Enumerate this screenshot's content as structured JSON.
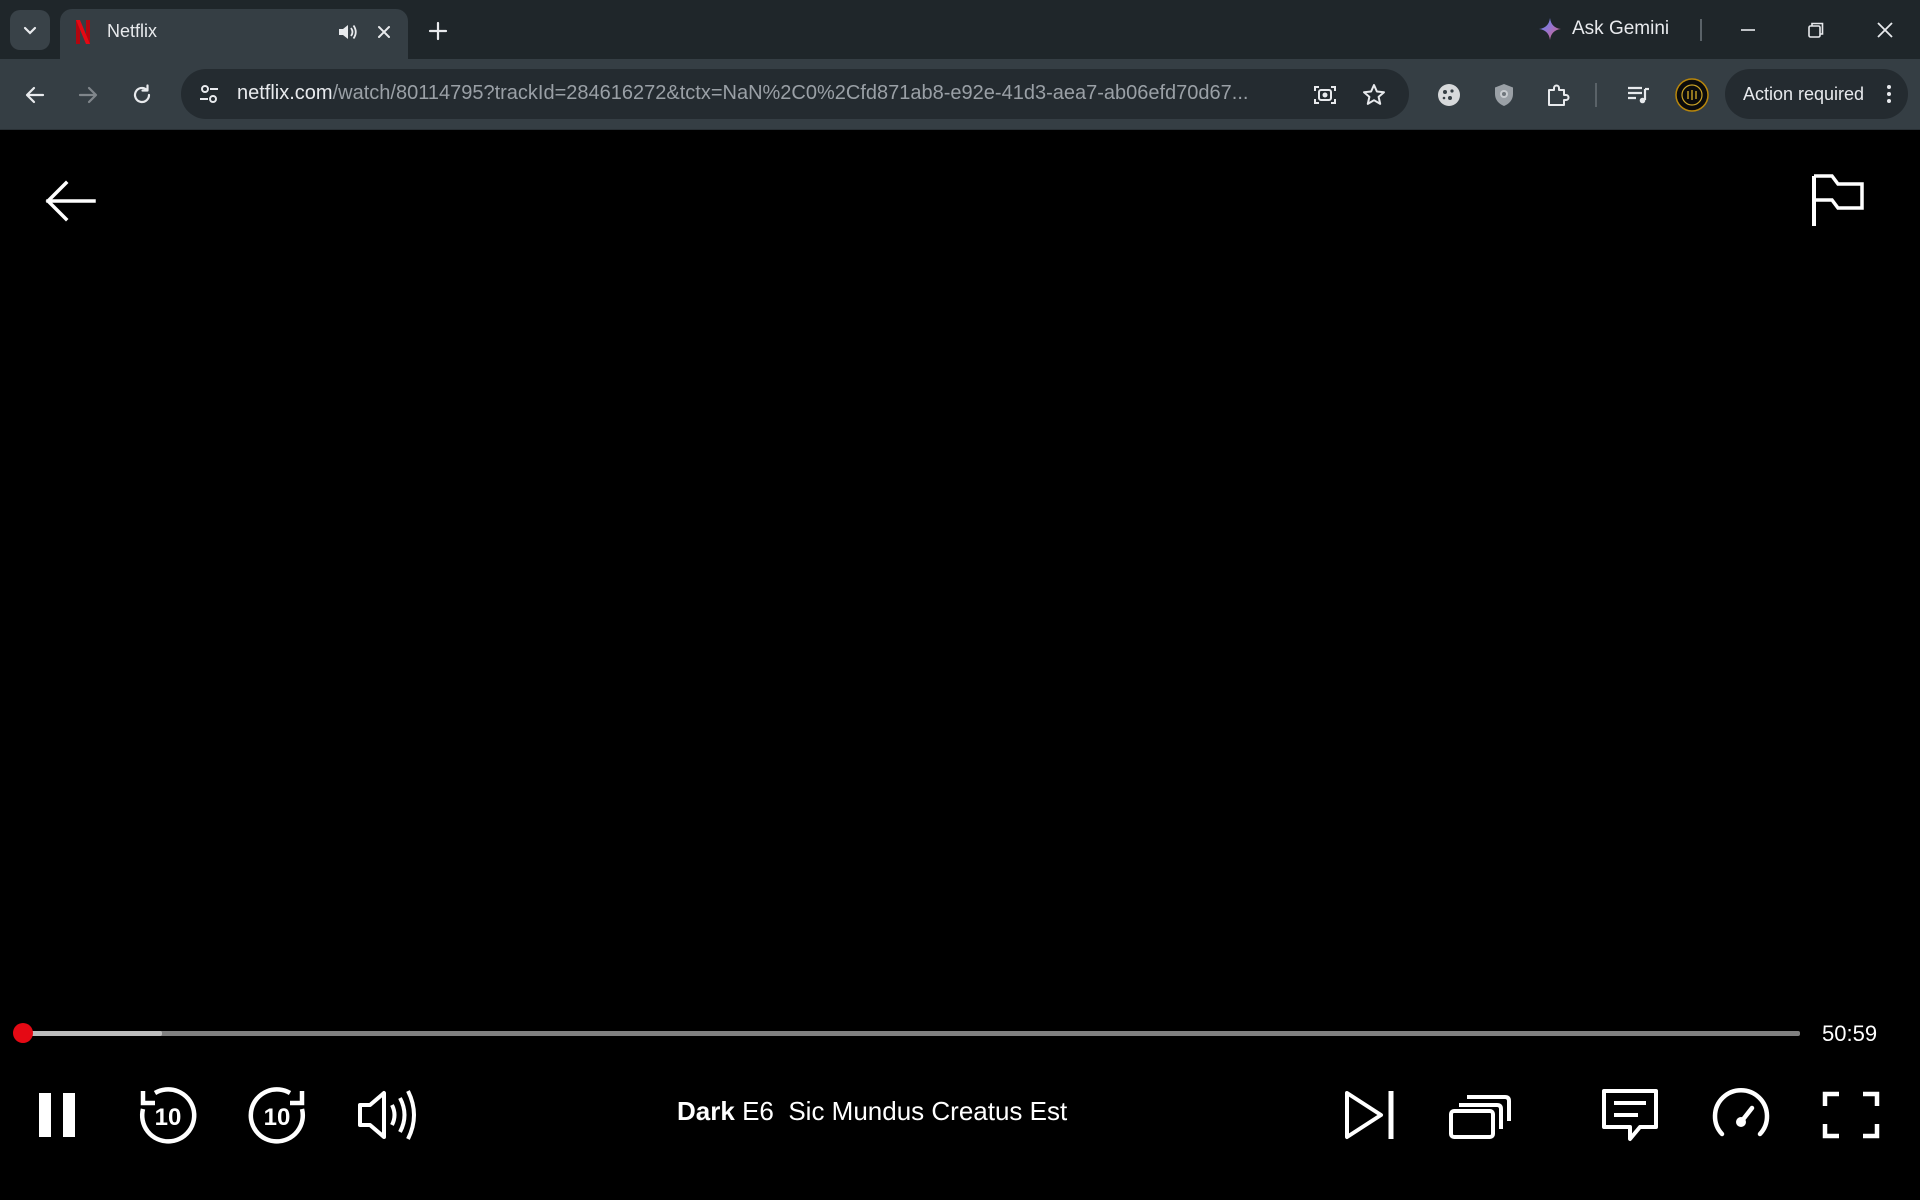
{
  "browser": {
    "tab": {
      "title": "Netflix"
    },
    "gemini_label": "Ask Gemini",
    "url_host": "netflix.com",
    "url_path": "/watch/80114795?trackId=284616272&tctx=NaN%2C0%2Cfd871ab8-e92e-41d3-aea7-ab06efd70d67...",
    "action_required_label": "Action required",
    "colors": {
      "tab_bar": "#1f262a",
      "toolbar": "#353e44",
      "omnibox": "#242b30",
      "netflix_red": "#e50914"
    }
  },
  "player": {
    "time_remaining": "50:59",
    "progress_fraction": 0.003,
    "buffered_fraction": 0.081,
    "show_name": "Dark",
    "episode_label": "E6",
    "episode_name": "Sic Mundus Creatus Est",
    "skip_seconds": "10",
    "icons": [
      "back-arrow-icon",
      "flag-icon",
      "pause-icon",
      "rewind-10-icon",
      "forward-10-icon",
      "volume-icon",
      "next-episode-icon",
      "episodes-icon",
      "subtitles-icon",
      "playback-speed-icon",
      "fullscreen-icon"
    ]
  }
}
